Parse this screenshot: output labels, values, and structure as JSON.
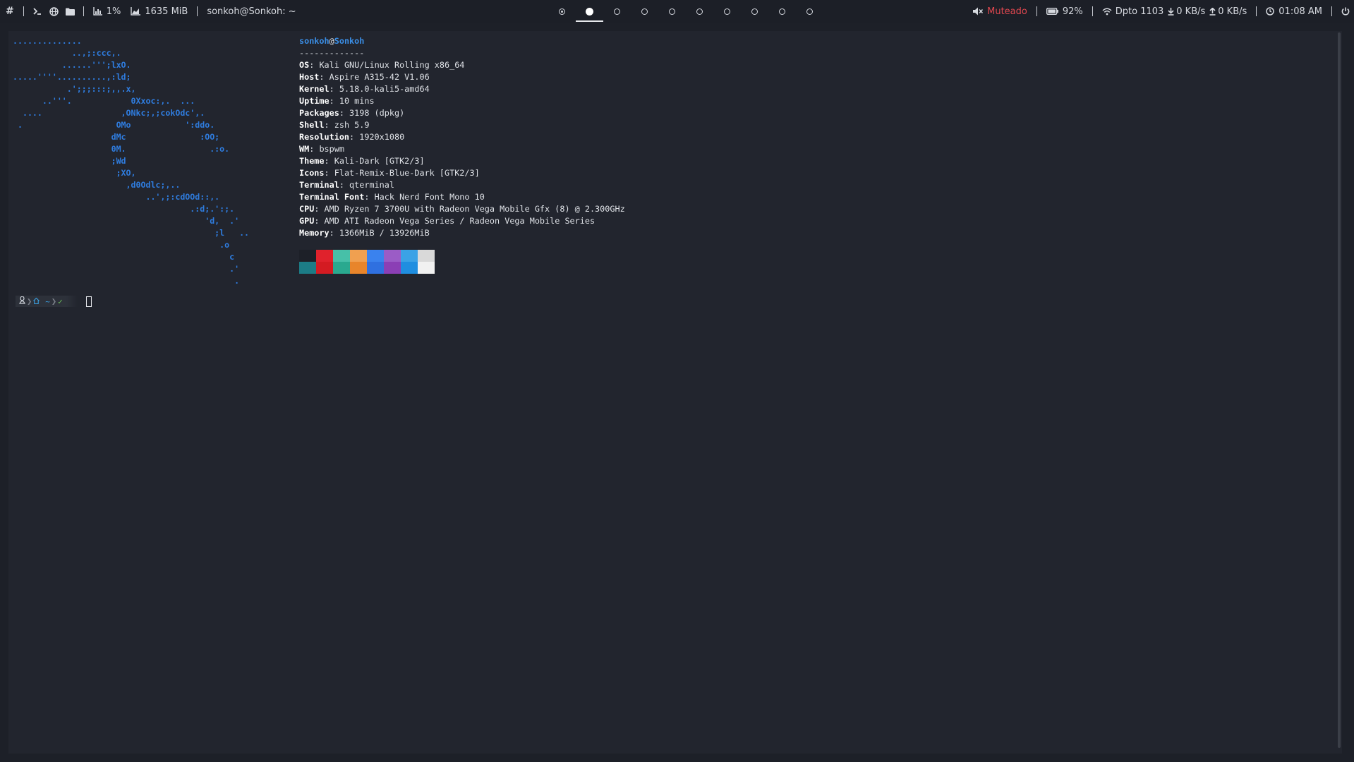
{
  "topbar": {
    "hash_label": "#",
    "cpu_percent": "1%",
    "ram_used": "1635 MiB",
    "window_title": "sonkoh@Sonkoh: ~",
    "workspaces": [
      {
        "state": "occupied"
      },
      {
        "state": "active"
      },
      {
        "state": "empty"
      },
      {
        "state": "empty"
      },
      {
        "state": "empty"
      },
      {
        "state": "empty"
      },
      {
        "state": "empty"
      },
      {
        "state": "empty"
      },
      {
        "state": "empty"
      },
      {
        "state": "empty"
      }
    ],
    "volume_label": "Muteado",
    "battery_percent": "92%",
    "wifi_name": "Dpto 1103",
    "download_rate": "0 KB/s",
    "upload_rate": "0 KB/s",
    "clock": "01:08 AM",
    "colors": {
      "bar_bg": "#1c1f27",
      "text": "#d7dae0",
      "muted": "#e0474f"
    }
  },
  "terminal": {
    "logo_lines": [
      "..............",
      "            ..,;:ccc,.",
      "          ......''';lxO.",
      ".....''''..........,:ld;",
      "           .';;;:::;,,.x,",
      "      ..'''.            0Xxoc:,.  ...",
      "  ....                ,ONkc;,;cokOdc',.",
      " .                   OMo           ':ddo.",
      "                    dMc               :OO;",
      "                    0M.                 .:o.",
      "                    ;Wd",
      "                     ;XO,",
      "                       ,d0Odlc;,..",
      "                           ..',;:cdOOd::,.",
      "                                    .:d;.':;.",
      "                                       'd,  .'",
      "                                         ;l   ..",
      "                                          .o",
      "                                            c",
      "                                            .'",
      "                                             ."
    ],
    "neofetch": {
      "user": "sonkoh",
      "at": "@",
      "host": "Sonkoh",
      "separator": "-------------",
      "fields": [
        {
          "key": "OS",
          "value": "Kali GNU/Linux Rolling x86_64"
        },
        {
          "key": "Host",
          "value": "Aspire A315-42 V1.06"
        },
        {
          "key": "Kernel",
          "value": "5.18.0-kali5-amd64"
        },
        {
          "key": "Uptime",
          "value": "10 mins"
        },
        {
          "key": "Packages",
          "value": "3198 (dpkg)"
        },
        {
          "key": "Shell",
          "value": "zsh 5.9"
        },
        {
          "key": "Resolution",
          "value": "1920x1080"
        },
        {
          "key": "WM",
          "value": "bspwm"
        },
        {
          "key": "Theme",
          "value": "Kali-Dark [GTK2/3]"
        },
        {
          "key": "Icons",
          "value": "Flat-Remix-Blue-Dark [GTK2/3]"
        },
        {
          "key": "Terminal",
          "value": "qterminal"
        },
        {
          "key": "Terminal Font",
          "value": "Hack Nerd Font Mono 10"
        },
        {
          "key": "CPU",
          "value": "AMD Ryzen 7 3700U with Radeon Vega Mobile Gfx (8) @ 2.300GHz"
        },
        {
          "key": "GPU",
          "value": "AMD ATI Radeon Vega Series / Radeon Vega Mobile Series"
        },
        {
          "key": "Memory",
          "value": "1366MiB / 13926MiB"
        }
      ],
      "palette_dark": [
        "#1c7c86",
        "#d41b22",
        "#2aa98f",
        "#e8852b",
        "#2f70e0",
        "#8b3fb5",
        "#1f8ee0",
        "#f1f1f1"
      ],
      "palette_bright": [
        "#1d2028",
        "#e0222c",
        "#47c0a8",
        "#f0a050",
        "#3a82ee",
        "#9b5cc6",
        "#3ba2e6",
        "#d9d9d9"
      ]
    },
    "prompt": {
      "home_symbol": "~",
      "status_symbol": "✓"
    },
    "colors": {
      "bg": "#22252e",
      "logo": "#2f7de0",
      "logo_accent": "#2ba6a6",
      "user": "#3a8ee6"
    }
  }
}
